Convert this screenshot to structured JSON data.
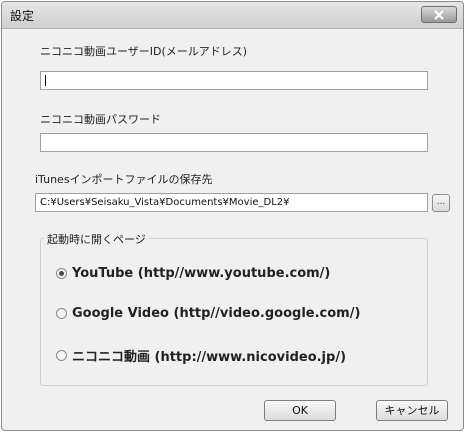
{
  "window": {
    "title": "設定"
  },
  "form": {
    "user_id_label": "ニコニコ動画ユーザーID(メールアドレス)",
    "user_id_value": "",
    "password_label": "ニコニコ動画パスワード",
    "password_value": "",
    "itunes_label": "iTunesインポートファイルの保存先",
    "itunes_path": "C:¥Users¥Seisaku_Vista¥Documents¥Movie_DL2¥",
    "browse_label": "..."
  },
  "startup_page": {
    "group_title": "起動時に開くページ",
    "options": [
      {
        "label": "YouTube (http//www.youtube.com/)",
        "selected": true
      },
      {
        "label": "Google Video (http//video.google.com/)",
        "selected": false
      },
      {
        "label": "ニコニコ動画 (http://www.nicovideo.jp/)",
        "selected": false
      }
    ]
  },
  "buttons": {
    "ok": "OK",
    "cancel": "キャンセル"
  }
}
